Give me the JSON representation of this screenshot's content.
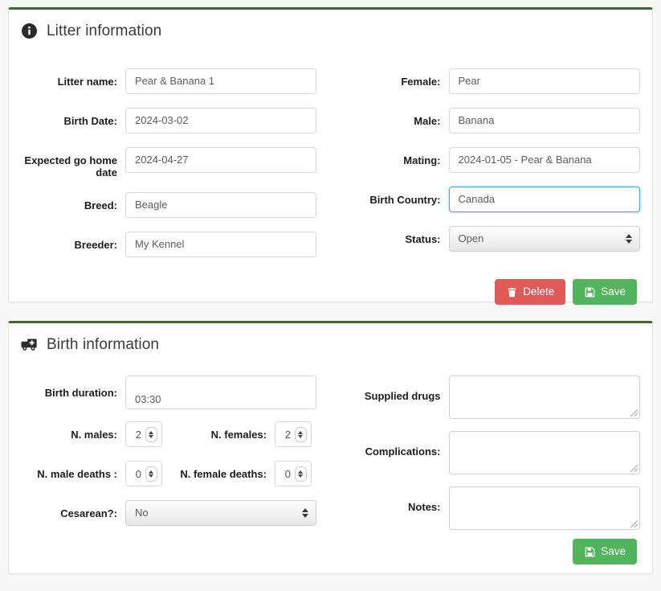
{
  "theme": {
    "card_top_border": "#3d6b1f",
    "page_bg": "#f7f7f7",
    "danger": "#e05a57",
    "success": "#52b45c",
    "focus_border": "#4a9fe8"
  },
  "litter_card": {
    "icon": "info-circle-icon",
    "title": "Litter information",
    "left_fields": [
      {
        "label": "Litter name:",
        "value": "Pear & Banana 1",
        "type": "text",
        "name": "litter-name"
      },
      {
        "label": "Birth Date:",
        "value": "2024-03-02",
        "type": "text",
        "name": "birth-date"
      },
      {
        "label": "Expected go home date",
        "value": "2024-04-27",
        "type": "text",
        "name": "expected-go-home-date"
      },
      {
        "label": "Breed:",
        "value": "Beagle",
        "type": "text",
        "name": "breed"
      },
      {
        "label": "Breeder:",
        "value": "My Kennel",
        "type": "text",
        "name": "breeder"
      }
    ],
    "right_fields": [
      {
        "label": "Female:",
        "value": "Pear",
        "type": "text",
        "name": "female"
      },
      {
        "label": "Male:",
        "value": "Banana",
        "type": "text",
        "name": "male"
      },
      {
        "label": "Mating:",
        "value": "2024-01-05 - Pear & Banana",
        "type": "text",
        "name": "mating"
      },
      {
        "label": "Birth Country:",
        "value": "Canada",
        "type": "text",
        "name": "birth-country",
        "focused": true
      },
      {
        "label": "Status:",
        "value": "Open",
        "type": "select",
        "name": "status"
      }
    ],
    "buttons": {
      "delete": {
        "label": "Delete",
        "icon": "trash-icon"
      },
      "save": {
        "label": "Save",
        "icon": "floppy-disk-icon"
      }
    }
  },
  "birth_card": {
    "icon": "ambulance-icon",
    "title": "Birth information",
    "duration": {
      "label": "Birth duration:",
      "value": "03:30"
    },
    "counts": [
      {
        "a": {
          "label": "N. males:",
          "value": "2",
          "name": "n-males"
        },
        "b": {
          "label": "N. females:",
          "value": "2",
          "name": "n-females"
        }
      },
      {
        "a": {
          "label": "N. male deaths :",
          "value": "0",
          "name": "n-male-deaths"
        },
        "b": {
          "label": "N. female deaths:",
          "value": "0",
          "name": "n-female-deaths"
        }
      }
    ],
    "cesarean": {
      "label": "Cesarean?:",
      "value": "No"
    },
    "right_fields": [
      {
        "label": "Supplied drugs",
        "value": "",
        "name": "supplied-drugs"
      },
      {
        "label": "Complications:",
        "value": "",
        "name": "complications"
      },
      {
        "label": "Notes:",
        "value": "",
        "name": "notes"
      }
    ],
    "buttons": {
      "save": {
        "label": "Save",
        "icon": "floppy-disk-icon"
      }
    }
  }
}
